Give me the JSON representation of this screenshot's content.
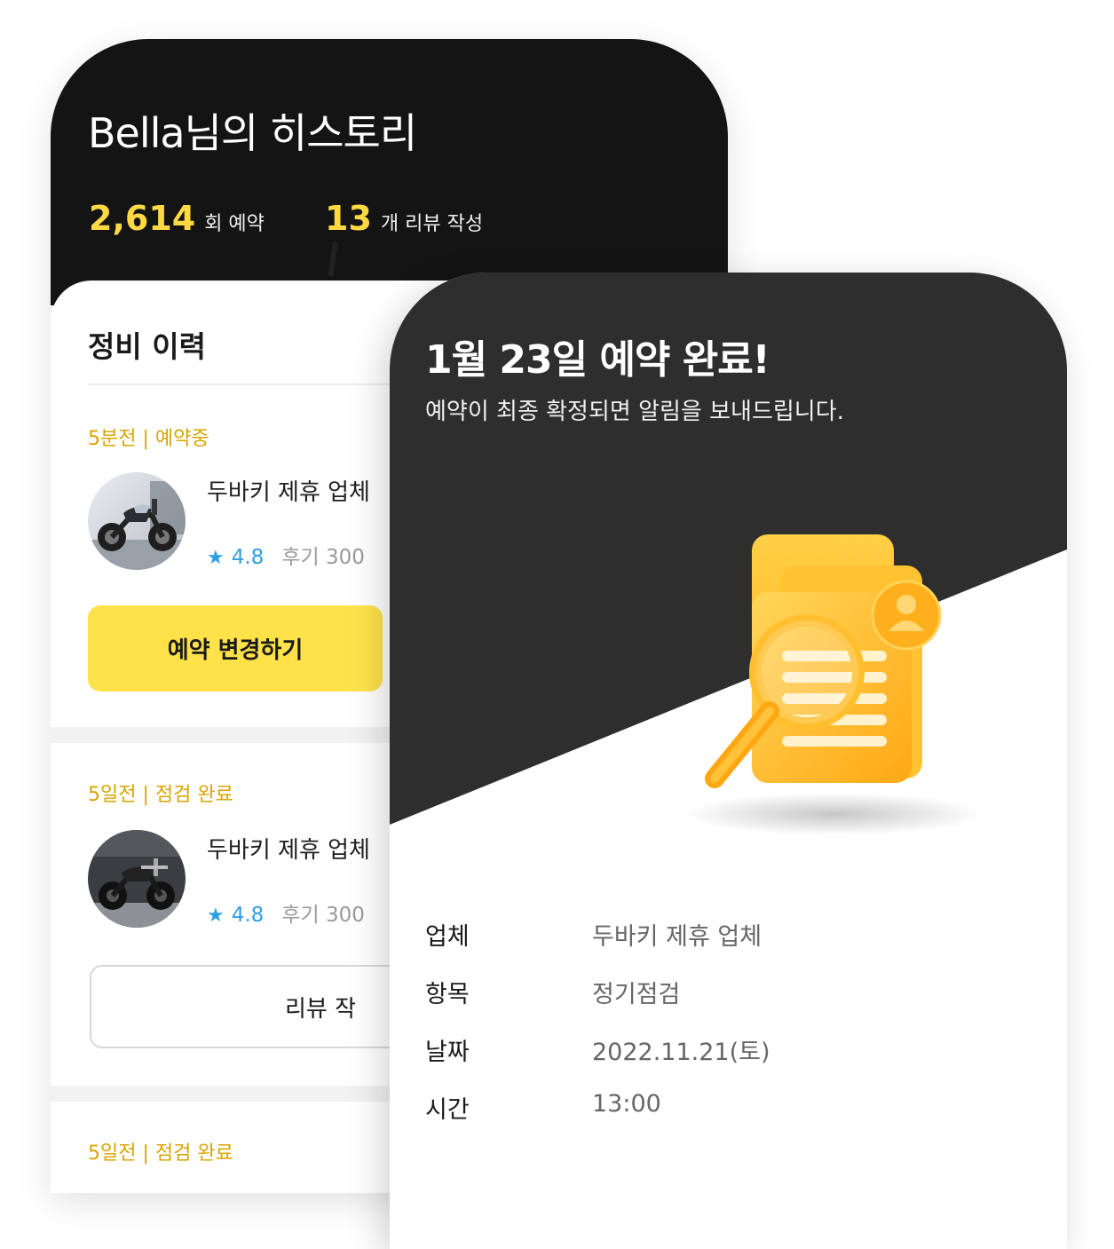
{
  "history": {
    "title": "Bella님의 히스토리",
    "stats": [
      {
        "value": "2,614",
        "label": "회 예약"
      },
      {
        "value": "13",
        "label": "개 리뷰 작성"
      }
    ],
    "section_title": "정비 이력",
    "items": [
      {
        "status": "5분전 | 예약중",
        "vendor": "두바키 제휴 업체",
        "rating": "4.8",
        "reviews": "후기 300",
        "button": "예약 변경하기",
        "thumb_icon": "motorcycle-photo"
      },
      {
        "status": "5일전 | 점검 완료",
        "vendor": "두바키 제휴 업체",
        "rating": "4.8",
        "reviews": "후기 300",
        "button": "리뷰 작",
        "thumb_icon": "motorcycle-photo"
      },
      {
        "status": "5일전 | 점검 완료"
      }
    ],
    "colors": {
      "accent": "#ffd942",
      "button": "#ffe24a",
      "status": "#d9a400",
      "rating": "#2f9fe4",
      "header": "#141414"
    }
  },
  "confirmation": {
    "title": "1월 23일 예약 완료!",
    "subtitle": "예약이 최종 확정되면 알림을 보내드립니다.",
    "illustration_icon": "document-search-icon",
    "details": [
      {
        "label": "업체",
        "value": "두바키 제휴 업체"
      },
      {
        "label": "항목",
        "value": "정기점검"
      },
      {
        "label": "날짜",
        "value": "2022.11.21(토)"
      },
      {
        "label": "시간",
        "value": "13:00"
      }
    ],
    "colors": {
      "header": "#2e2e2e",
      "illustration": "#ffb81c"
    }
  }
}
